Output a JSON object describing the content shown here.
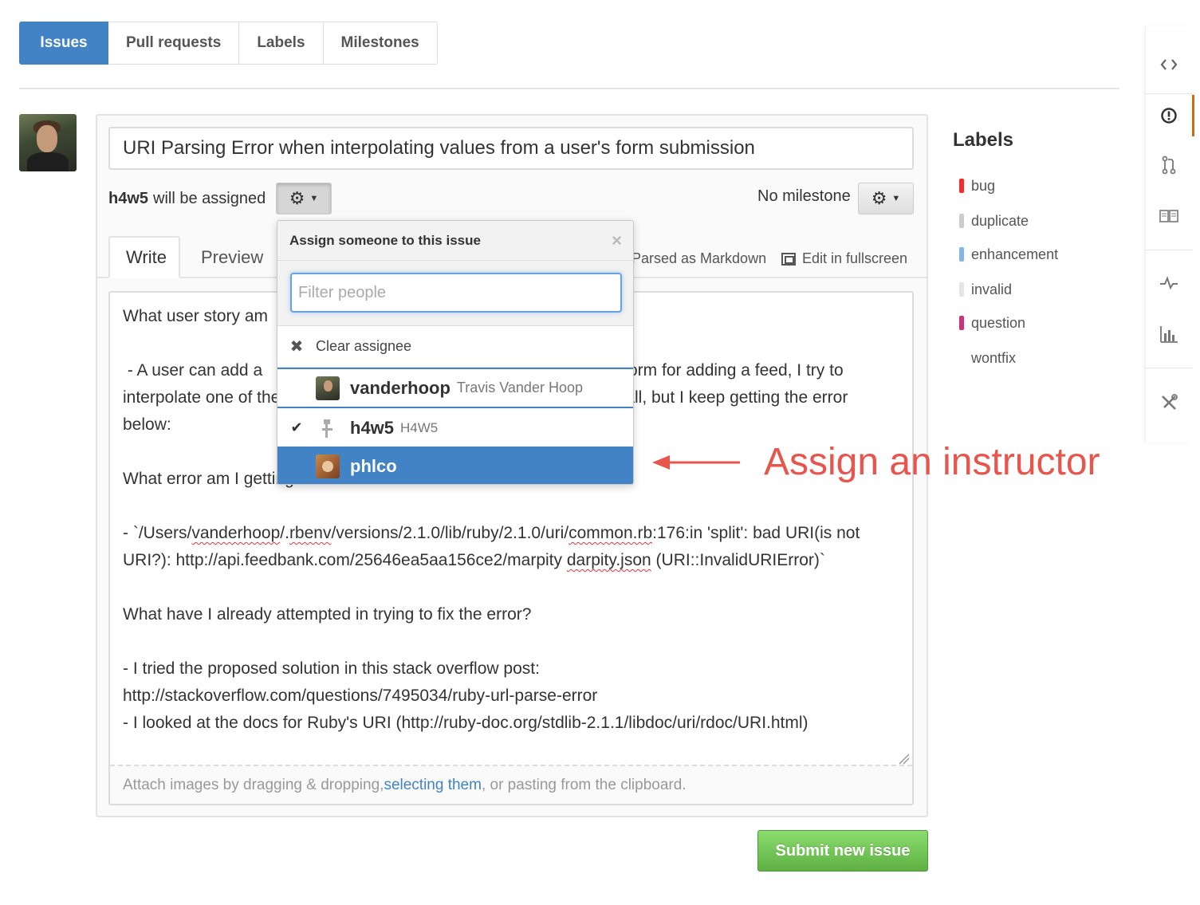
{
  "tabs": [
    {
      "label": "Issues",
      "active": true
    },
    {
      "label": "Pull requests",
      "active": false
    },
    {
      "label": "Labels",
      "active": false
    },
    {
      "label": "Milestones",
      "active": false
    }
  ],
  "issue": {
    "title": "URI Parsing Error when interpolating values from a user's form submission",
    "assignee_user": "h4w5",
    "assignee_suffix": "will be assigned",
    "milestone": "No milestone",
    "editor_tabs": [
      "Write",
      "Preview"
    ],
    "markdown_note": "Parsed as Markdown",
    "fullscreen_label": "Edit in fullscreen",
    "body": {
      "l1": "What user story am",
      "l2": " - A user can add a",
      "l2r": "the form for adding a feed, I try to",
      "l3": "interpolate one of the",
      "l3r": "all, but I keep getting the error",
      "l4": "below:",
      "l5": "What error am I getting?",
      "l6a": "- `/Users/",
      "l6b": "vanderhoop",
      "l6c": "/.",
      "l6d": "rbenv",
      "l6e": "/versions/2.1.0/lib/ruby/2.1.0/uri/",
      "l6f": "common.rb",
      "l6g": ":176:in 'split': bad URI(is not",
      "l7a": "URI?): http://api.feedbank.com/25646ea5aa156ce2/marpity ",
      "l7b": "darpity.json",
      "l7c": " (URI::InvalidURIError)`",
      "l8": "What have I already attempted in trying to fix the error?",
      "l9": "- I tried the proposed solution in this stack overflow post:",
      "l10": "http://stackoverflow.com/questions/7495034/ruby-url-parse-error",
      "l11": "- I looked at the docs for Ruby's URI (http://ruby-doc.org/stdlib-2.1.1/libdoc/uri/rdoc/URI.html)"
    },
    "attach": {
      "before": "Attach images by dragging & dropping, ",
      "link": "selecting them",
      "after": ", or pasting from the clipboard."
    },
    "submit_label": "Submit new issue"
  },
  "assign_dropdown": {
    "header": "Assign someone to this issue",
    "close_glyph": "×",
    "filter_placeholder": "Filter people",
    "clear_label": "Clear assignee",
    "people": [
      {
        "username": "vanderhoop",
        "fullname": "Travis Vander Hoop",
        "selected": false
      },
      {
        "username": "h4w5",
        "fullname": "H4W5",
        "selected": true
      },
      {
        "username": "phlco",
        "fullname": "",
        "selected": false,
        "highlighted": true
      }
    ]
  },
  "annotation": {
    "text": "Assign an instructor",
    "color": "#e8554c"
  },
  "labels": {
    "title": "Labels",
    "items": [
      {
        "name": "bug",
        "color": "#fc2929"
      },
      {
        "name": "duplicate",
        "color": "#cccccc"
      },
      {
        "name": "enhancement",
        "color": "#84b6eb"
      },
      {
        "name": "invalid",
        "color": "#e6e6e6"
      },
      {
        "name": "question",
        "color": "#cc317c"
      },
      {
        "name": "wontfix",
        "color": "#ffffff"
      }
    ]
  },
  "repo_nav": [
    "code-icon",
    "issues-icon",
    "pull-requests-icon",
    "wiki-icon",
    "pulse-icon",
    "graphs-icon",
    "settings-icon"
  ],
  "colors": {
    "accent": "#4183c4",
    "submit_green": "#60b044",
    "nav_active": "#d26911"
  }
}
